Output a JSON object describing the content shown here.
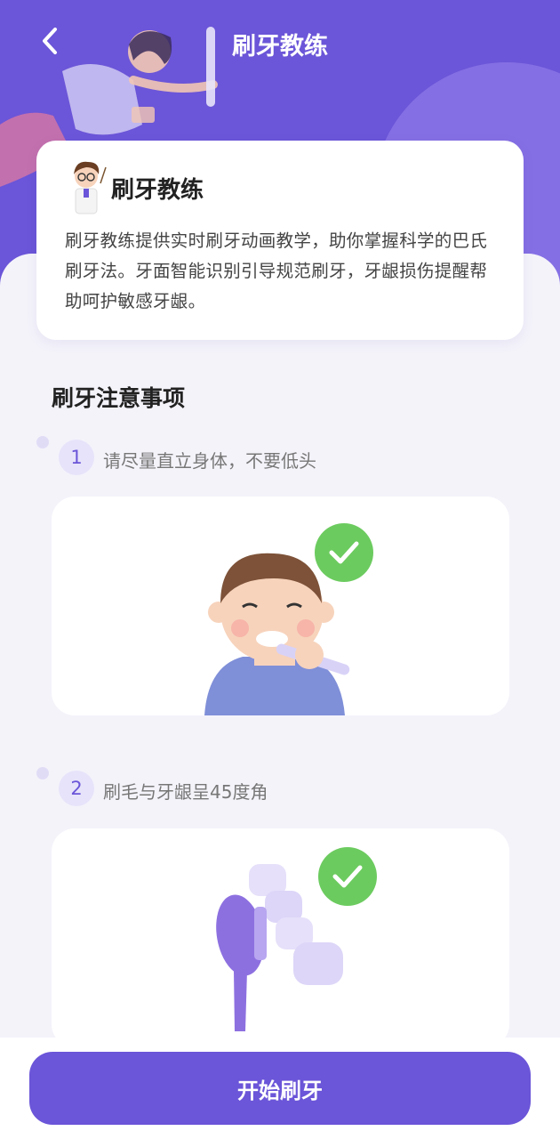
{
  "header": {
    "title": "刷牙教练",
    "back_icon": "chevron-left-icon"
  },
  "intro_card": {
    "title": "刷牙教练",
    "description": "刷牙教练提供实时刷牙动画教学，助你掌握科学的巴氏刷牙法。牙面智能识别引导规范刷牙，牙龈损伤提醒帮助呵护敏感牙龈。"
  },
  "notes": {
    "title": "刷牙注意事项",
    "steps": [
      {
        "number": "1",
        "text": "请尽量直立身体，不要低头",
        "illustration": "boy-brushing-teeth-upright",
        "badge": "check-icon"
      },
      {
        "number": "2",
        "text": "刷毛与牙龈呈45度角",
        "illustration": "toothbrush-head-and-teeth",
        "badge": "check-icon"
      }
    ]
  },
  "footer": {
    "start_label": "开始刷牙"
  },
  "colors": {
    "primary": "#6B55D8",
    "check_green": "#6CCB5F",
    "background": "#F4F3FA"
  }
}
